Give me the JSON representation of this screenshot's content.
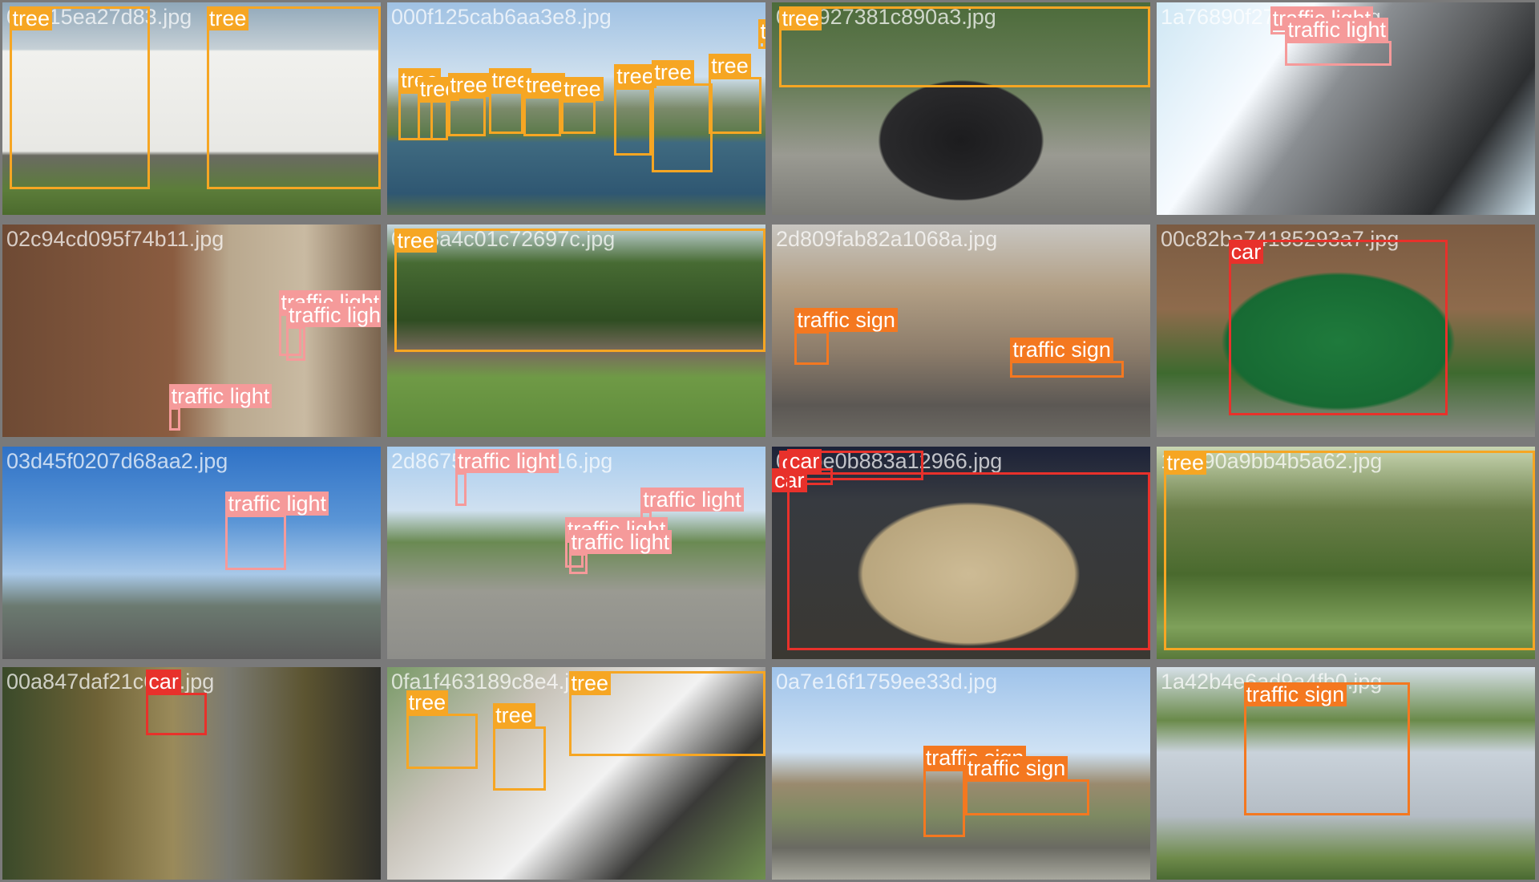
{
  "classes": {
    "tree": {
      "color": "#f6a623"
    },
    "car": {
      "color": "#e8312b"
    },
    "traffic light": {
      "color": "#f59a9a"
    },
    "traffic sign": {
      "color": "#f47820"
    }
  },
  "tiles": [
    {
      "file": "0f9215ea27d83.jpg",
      "theme": "house",
      "boxes": [
        {
          "c": "tree",
          "b": [
            0.02,
            0.02,
            0.39,
            0.88
          ],
          "in": 1
        },
        {
          "c": "tree",
          "b": [
            0.54,
            0.02,
            1.0,
            0.88
          ],
          "in": 1
        }
      ]
    },
    {
      "file": "000f125cab6aa3e8.jpg",
      "theme": "canal",
      "boxes": [
        {
          "c": "tree",
          "b": [
            0.98,
            0.08,
            1.0,
            0.22
          ]
        },
        {
          "c": "tree",
          "b": [
            0.03,
            0.42,
            0.12,
            0.65
          ]
        },
        {
          "c": "tree",
          "b": [
            0.08,
            0.46,
            0.16,
            0.65
          ]
        },
        {
          "c": "tree",
          "b": [
            0.16,
            0.44,
            0.26,
            0.63
          ]
        },
        {
          "c": "tree",
          "b": [
            0.27,
            0.42,
            0.36,
            0.62
          ]
        },
        {
          "c": "tree",
          "b": [
            0.36,
            0.44,
            0.46,
            0.63
          ]
        },
        {
          "c": "tree",
          "b": [
            0.46,
            0.46,
            0.55,
            0.62
          ]
        },
        {
          "c": "tree",
          "b": [
            0.6,
            0.4,
            0.7,
            0.72
          ]
        },
        {
          "c": "tree",
          "b": [
            0.7,
            0.38,
            0.86,
            0.8
          ]
        },
        {
          "c": "tree",
          "b": [
            0.85,
            0.35,
            0.99,
            0.62
          ]
        }
      ]
    },
    {
      "file": "0a2f927381c890a3.jpg",
      "theme": "blackcar",
      "boxes": [
        {
          "c": "tree",
          "b": [
            0.02,
            0.02,
            1.0,
            0.4
          ],
          "in": 1
        }
      ]
    },
    {
      "file": "1a76890f27c60a3e.jpg",
      "theme": "tilted",
      "boxes": [
        {
          "c": "traffic light",
          "b": [
            0.3,
            0.02,
            0.57,
            0.15
          ],
          "in": 1
        },
        {
          "c": "traffic light",
          "b": [
            0.34,
            0.18,
            0.62,
            0.3
          ]
        }
      ]
    },
    {
      "file": "02c94cd095f74b11.jpg",
      "theme": "street",
      "boxes": [
        {
          "c": "traffic light",
          "b": [
            0.73,
            0.42,
            0.79,
            0.62
          ]
        },
        {
          "c": "traffic light",
          "b": [
            0.75,
            0.48,
            0.8,
            0.64
          ]
        },
        {
          "c": "traffic light",
          "b": [
            0.44,
            0.86,
            0.47,
            0.97
          ]
        }
      ]
    },
    {
      "file": "0a08a4c01c72697c.jpg",
      "theme": "park",
      "boxes": [
        {
          "c": "tree",
          "b": [
            0.02,
            0.02,
            1.0,
            0.6
          ]
        }
      ]
    },
    {
      "file": "2d809fab82a1068a.jpg",
      "theme": "village",
      "boxes": [
        {
          "c": "traffic sign",
          "b": [
            0.06,
            0.5,
            0.15,
            0.66
          ]
        },
        {
          "c": "traffic sign",
          "b": [
            0.63,
            0.64,
            0.93,
            0.72
          ]
        }
      ]
    },
    {
      "file": "00c82ba74185293a7.jpg",
      "theme": "police",
      "boxes": [
        {
          "c": "car",
          "b": [
            0.19,
            0.07,
            0.77,
            0.9
          ]
        }
      ]
    },
    {
      "file": "03d45f0207d68aa2.jpg",
      "theme": "istanbul",
      "boxes": [
        {
          "c": "traffic light",
          "b": [
            0.59,
            0.32,
            0.75,
            0.58
          ]
        }
      ]
    },
    {
      "file": "2d8675fb42616016.jpg",
      "theme": "la",
      "boxes": [
        {
          "c": "traffic light",
          "b": [
            0.18,
            0.12,
            0.21,
            0.28
          ]
        },
        {
          "c": "traffic light",
          "b": [
            0.67,
            0.3,
            0.7,
            0.45
          ]
        },
        {
          "c": "traffic light",
          "b": [
            0.47,
            0.44,
            0.52,
            0.57
          ]
        },
        {
          "c": "traffic light",
          "b": [
            0.48,
            0.5,
            0.53,
            0.6
          ]
        }
      ]
    },
    {
      "file": "0c2be0b883a12966.jpg",
      "theme": "beige",
      "boxes": [
        {
          "c": "car",
          "b": [
            0.02,
            0.02,
            0.4,
            0.16
          ],
          "in": 1
        },
        {
          "c": "car",
          "b": [
            0.0,
            0.1,
            0.16,
            0.18
          ]
        },
        {
          "c": "car",
          "b": [
            0.04,
            0.12,
            1.0,
            0.96
          ]
        }
      ]
    },
    {
      "file": "1a5f90a9bb4b5a62.jpg",
      "theme": "jungle",
      "boxes": [
        {
          "c": "tree",
          "b": [
            0.02,
            0.02,
            1.0,
            0.96
          ],
          "in": 1
        }
      ]
    },
    {
      "file": "00a847daf21c6eff.jpg",
      "theme": "police2",
      "boxes": [
        {
          "c": "car",
          "b": [
            0.38,
            0.12,
            0.54,
            0.32
          ]
        }
      ]
    },
    {
      "file": "0fa1f463189c8e4.jpg",
      "theme": "violin",
      "boxes": [
        {
          "c": "tree",
          "b": [
            0.48,
            0.02,
            1.0,
            0.42
          ],
          "in": 1
        },
        {
          "c": "tree",
          "b": [
            0.05,
            0.22,
            0.24,
            0.48
          ]
        },
        {
          "c": "tree",
          "b": [
            0.28,
            0.28,
            0.42,
            0.58
          ]
        }
      ]
    },
    {
      "file": "0a7e16f1759ee33d.jpg",
      "theme": "desert",
      "boxes": [
        {
          "c": "traffic sign",
          "b": [
            0.4,
            0.48,
            0.51,
            0.8
          ]
        },
        {
          "c": "traffic sign",
          "b": [
            0.51,
            0.53,
            0.84,
            0.7
          ]
        }
      ]
    },
    {
      "file": "1a42b4e6ad9a4fb0.jpg",
      "theme": "pance",
      "boxes": [
        {
          "c": "traffic sign",
          "b": [
            0.23,
            0.07,
            0.67,
            0.7
          ]
        }
      ]
    }
  ]
}
